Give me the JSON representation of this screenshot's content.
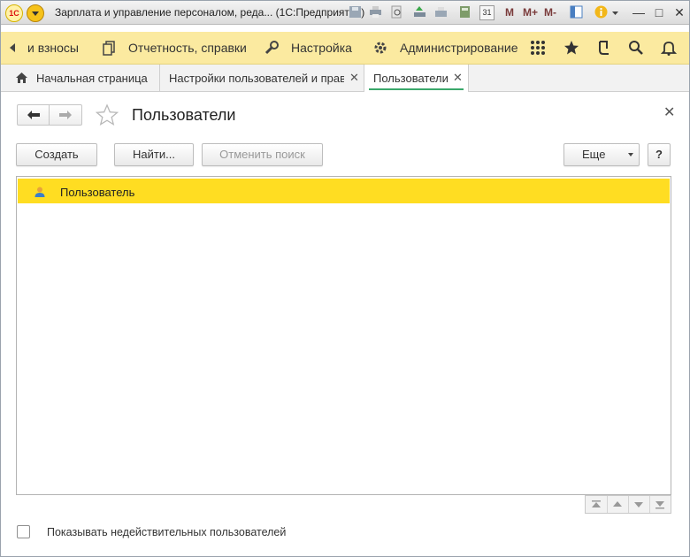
{
  "window": {
    "title": "Зарплата и управление персоналом, реда... (1С:Предприятие)",
    "toolbar_m": "M",
    "toolbar_mplus": "M+",
    "toolbar_mminus": "M-",
    "calendar_day": "31"
  },
  "sections": {
    "items": [
      {
        "label": "и взносы"
      },
      {
        "label": "Отчетность, справки"
      },
      {
        "label": "Настройка"
      },
      {
        "label": "Администрирование"
      }
    ]
  },
  "tabs": [
    {
      "label": "Начальная страница"
    },
    {
      "label": "Настройки пользователей и прав"
    },
    {
      "label": "Пользователи"
    }
  ],
  "form": {
    "title": "Пользователи",
    "buttons": {
      "create": "Создать",
      "find": "Найти...",
      "cancel_search": "Отменить поиск",
      "more": "Еще",
      "help": "?"
    },
    "list": {
      "rows": [
        {
          "label": "Пользователь",
          "selected": true
        }
      ]
    },
    "show_invalid_label": "Показывать недействительных пользователей",
    "show_invalid_checked": false
  },
  "colors": {
    "section_bg": "#fbeaa0",
    "selection": "#ffdd22",
    "active_tab_underline": "#3aa86b"
  }
}
